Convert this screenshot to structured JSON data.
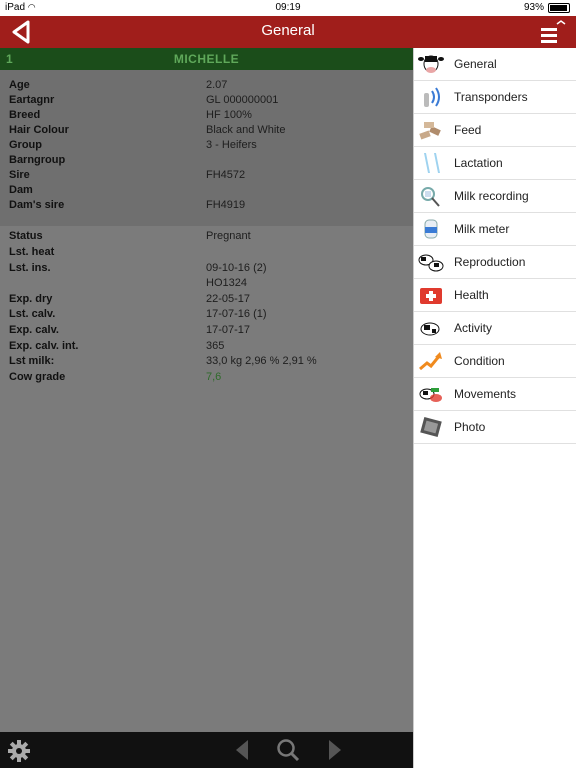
{
  "status_bar": {
    "device": "iPad",
    "time": "09:19",
    "battery": "93%",
    "battery_level": 0.93
  },
  "header": {
    "title": "General"
  },
  "cow": {
    "number": "1",
    "name": "MICHELLE"
  },
  "details1": [
    {
      "label": "Age",
      "value": "2.07"
    },
    {
      "label": "Eartagnr",
      "value": "GL 000000001"
    },
    {
      "label": "Breed",
      "value": "HF 100%"
    },
    {
      "label": "Hair Colour",
      "value": "Black and White"
    },
    {
      "label": "Group",
      "value": "3 - Heifers"
    },
    {
      "label": "Barngroup",
      "value": ""
    },
    {
      "label": "Sire",
      "value": "FH4572"
    },
    {
      "label": "Dam",
      "value": ""
    },
    {
      "label": "Dam's sire",
      "value": "FH4919"
    }
  ],
  "details2": [
    {
      "label": "Status",
      "value": "Pregnant"
    },
    {
      "label": "Lst. heat",
      "value": ""
    },
    {
      "label": "Lst. ins.",
      "value": "09-10-16 (2)"
    },
    {
      "label": "",
      "value": "HO1324"
    },
    {
      "label": "Exp. dry",
      "value": "22-05-17"
    },
    {
      "label": "Lst. calv.",
      "value": "17-07-16 (1)"
    },
    {
      "label": "Exp. calv.",
      "value": "17-07-17"
    },
    {
      "label": "Exp. calv. int.",
      "value": "365"
    },
    {
      "label": "Lst milk:",
      "value": "33,0 kg 2,96 %  2,91 %"
    },
    {
      "label": "Cow grade",
      "value": "7,6",
      "color": "#2e6b2a"
    }
  ],
  "sidebar": {
    "items": [
      {
        "label": "General",
        "icon": "cow-head-icon"
      },
      {
        "label": "Transponders",
        "icon": "transponder-icon"
      },
      {
        "label": "Feed",
        "icon": "feed-icon"
      },
      {
        "label": "Lactation",
        "icon": "lactation-icon"
      },
      {
        "label": "Milk recording",
        "icon": "milk-recording-icon"
      },
      {
        "label": "Milk meter",
        "icon": "milk-meter-icon"
      },
      {
        "label": "Reproduction",
        "icon": "reproduction-icon"
      },
      {
        "label": "Health",
        "icon": "first-aid-icon"
      },
      {
        "label": "Activity",
        "icon": "activity-icon"
      },
      {
        "label": "Condition",
        "icon": "condition-icon"
      },
      {
        "label": "Movements",
        "icon": "movements-icon"
      },
      {
        "label": "Photo",
        "icon": "photo-icon"
      }
    ]
  },
  "colors": {
    "header": "#a01e1b",
    "cowbar": "#1b4d1a",
    "cowbar_text": "#5fa85a",
    "panel": "#7b7b7b",
    "bottombar": "#111111"
  }
}
